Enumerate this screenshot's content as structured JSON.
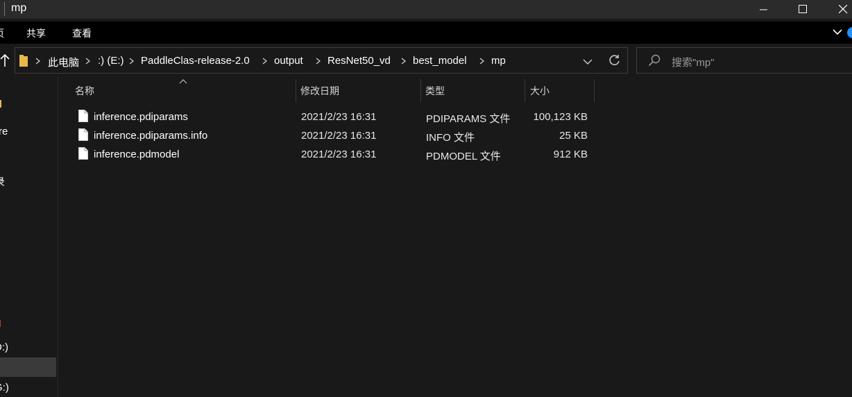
{
  "window": {
    "title": "mp"
  },
  "ribbon": {
    "tabs": [
      "页",
      "共享",
      "查看"
    ]
  },
  "address": {
    "breadcrumbs": [
      "此电脑",
      ":) (E:)",
      "PaddleClas-release-2.0",
      "output",
      "ResNet50_vd",
      "best_model",
      "mp"
    ]
  },
  "search": {
    "placeholder": "搜索\"mp\""
  },
  "nav": {
    "fragments": [
      "",
      "re",
      "",
      "录",
      "",
      "D:)",
      "",
      "G:)"
    ]
  },
  "columns": {
    "name": "名称",
    "date": "修改日期",
    "type": "类型",
    "size": "大小"
  },
  "files": [
    {
      "name": "inference.pdiparams",
      "date": "2021/2/23 16:31",
      "type": "PDIPARAMS 文件",
      "size": "100,123 KB"
    },
    {
      "name": "inference.pdiparams.info",
      "date": "2021/2/23 16:31",
      "type": "INFO 文件",
      "size": "25 KB"
    },
    {
      "name": "inference.pdmodel",
      "date": "2021/2/23 16:31",
      "type": "PDMODEL 文件",
      "size": "912 KB"
    }
  ],
  "colors": {
    "background": "#191919",
    "titlebar": "#2b2b2b",
    "ribbon": "#000000",
    "folder": "#e8b84a",
    "accent": "#1e90ff"
  }
}
